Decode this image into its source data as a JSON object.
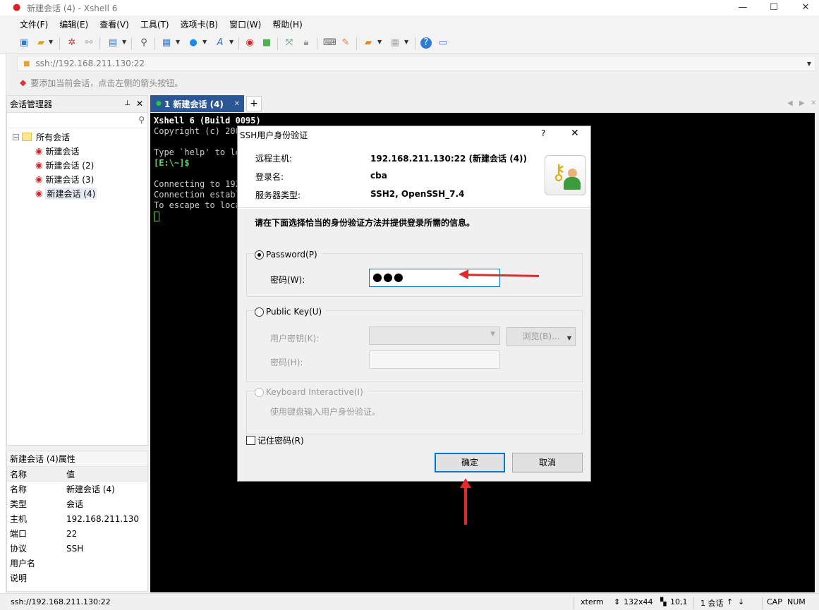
{
  "window": {
    "title": "新建会话 (4) - Xshell 6"
  },
  "menu": [
    "文件(F)",
    "编辑(E)",
    "查看(V)",
    "工具(T)",
    "选项卡(B)",
    "窗口(W)",
    "帮助(H)"
  ],
  "address": {
    "value": "ssh://192.168.211.130:22"
  },
  "hint": "要添加当前会话，点击左侧的箭头按钮。",
  "session_manager": {
    "title": "会话管理器",
    "root": "所有会话",
    "items": [
      "新建会话",
      "新建会话 (2)",
      "新建会话 (3)",
      "新建会话 (4)"
    ]
  },
  "properties": {
    "title": "新建会话 (4)属性",
    "header": {
      "name": "名称",
      "value": "值"
    },
    "rows": [
      {
        "k": "名称",
        "v": "新建会话 (4)"
      },
      {
        "k": "类型",
        "v": "会话"
      },
      {
        "k": "主机",
        "v": "192.168.211.130"
      },
      {
        "k": "端口",
        "v": "22"
      },
      {
        "k": "协议",
        "v": "SSH"
      },
      {
        "k": "用户名",
        "v": ""
      },
      {
        "k": "说明",
        "v": ""
      }
    ]
  },
  "tab": {
    "label": "1 新建会话 (4)"
  },
  "terminal": {
    "lines": [
      "Xshell 6 (Build 0095)",
      "Copyright (c) 200",
      "",
      "Type `help' to le",
      "[E:\\~]$",
      "",
      "Connecting to 192",
      "Connection establ",
      "To escape to loca"
    ]
  },
  "statusbar": {
    "address": "ssh://192.168.211.130:22",
    "term": "xterm",
    "size": "132x44",
    "pos": "10,1",
    "sessions": "1 会话",
    "cap": "CAP",
    "num": "NUM"
  },
  "dialog": {
    "title": "SSH用户身份验证",
    "help": "?",
    "remote_host_label": "远程主机:",
    "remote_host": "192.168.211.130:22 (新建会话 (4))",
    "login_label": "登录名:",
    "login": "cba",
    "server_type_label": "服务器类型:",
    "server_type": "SSH2, OpenSSH_7.4",
    "instruction": "请在下面选择恰当的身份验证方法并提供登录所需的信息。",
    "password_option": "Password(P)",
    "password_label": "密码(W):",
    "password_value": "●●●",
    "pubkey_option": "Public Key(U)",
    "user_key_label": "用户密钥(K):",
    "browse_label": "浏览(B)...",
    "key_password_label": "密码(H):",
    "keyboard_option": "Keyboard Interactive(I)",
    "keyboard_desc": "使用键盘输入用户身份验证。",
    "remember_label": "记住密码(R)",
    "ok_label": "确定",
    "cancel_label": "取消"
  },
  "colors": {
    "tab_active": "#2b5797",
    "accent": "#0078d7",
    "annotation": "#e12b2b"
  }
}
